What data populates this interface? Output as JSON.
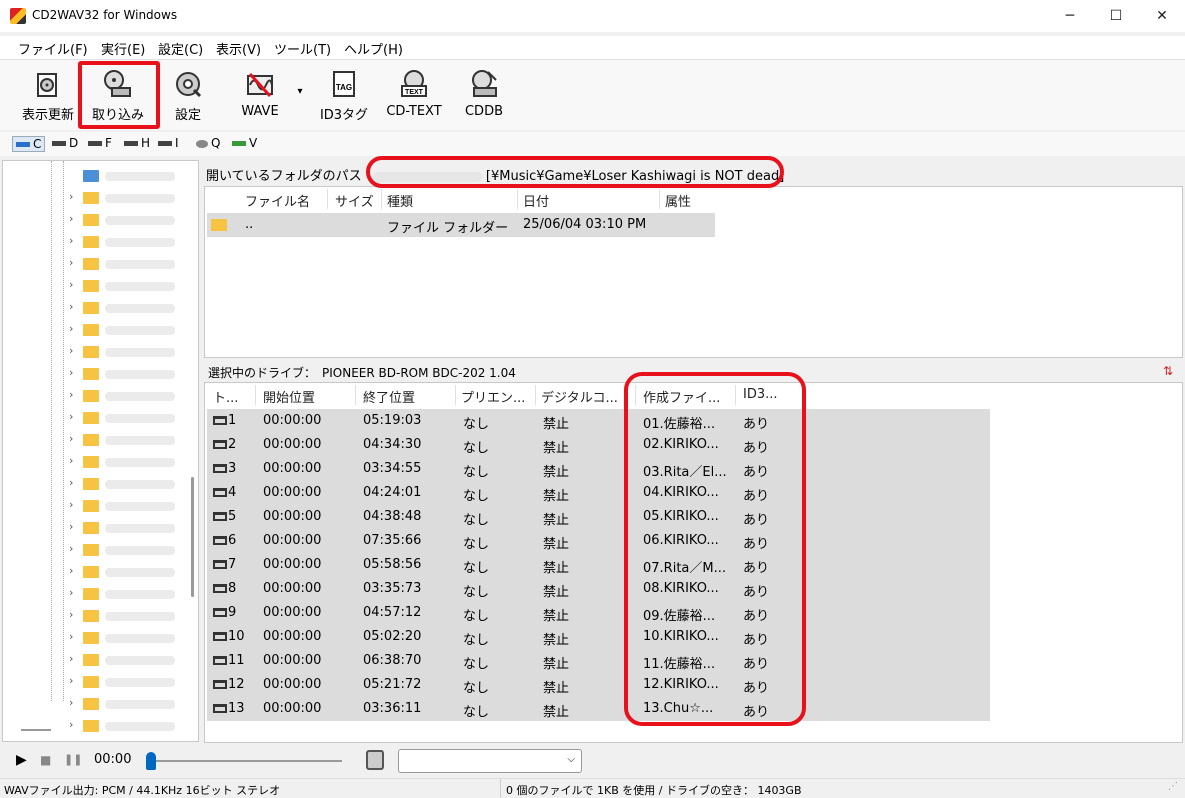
{
  "window": {
    "title": "CD2WAV32 for Windows",
    "minimize": "─",
    "maximize": "☐",
    "close": "✕"
  },
  "menu": [
    "ファイル(F)",
    "実行(E)",
    "設定(C)",
    "表示(V)",
    "ツール(T)",
    "ヘルプ(H)"
  ],
  "toolbar": {
    "refresh": "表示更新",
    "rip": "取り込み",
    "settings": "設定",
    "wave": "WAVE",
    "id3": "ID3タグ",
    "cdtext": "CD-TEXT",
    "cddb": "CDDB",
    "dropdown": "▾"
  },
  "drives": [
    "C",
    "D",
    "F",
    "H",
    "I",
    "Q",
    "V"
  ],
  "path": {
    "label": "開いているフォルダのパス",
    "value": "[¥Music¥Game¥Loser Kashiwagi is NOT dead]"
  },
  "filelist": {
    "headers": [
      "ファイル名",
      "サイズ",
      "種類",
      "日付",
      "属性"
    ],
    "rows": [
      {
        "name": "..",
        "size": "",
        "type": "ファイル フォルダー",
        "date": "25/06/04 03:10 PM",
        "attr": ""
      }
    ]
  },
  "drive_label": "選択中のドライブ：　PIONEER BD-ROM  BDC-202 1.04",
  "tracks": {
    "headers": [
      "ト...",
      "開始位置",
      "終了位置",
      "プリエン...",
      "デジタルコ...",
      "作成ファイ...",
      "ID3..."
    ],
    "rows": [
      [
        "1",
        "00:00:00",
        "05:19:03",
        "なし",
        "禁止",
        "01.佐藤裕...",
        "あり"
      ],
      [
        "2",
        "00:00:00",
        "04:34:30",
        "なし",
        "禁止",
        "02.KIRIKO...",
        "あり"
      ],
      [
        "3",
        "00:00:00",
        "03:34:55",
        "なし",
        "禁止",
        "03.Rita／El...",
        "あり"
      ],
      [
        "4",
        "00:00:00",
        "04:24:01",
        "なし",
        "禁止",
        "04.KIRIKO...",
        "あり"
      ],
      [
        "5",
        "00:00:00",
        "04:38:48",
        "なし",
        "禁止",
        "05.KIRIKO...",
        "あり"
      ],
      [
        "6",
        "00:00:00",
        "07:35:66",
        "なし",
        "禁止",
        "06.KIRIKO...",
        "あり"
      ],
      [
        "7",
        "00:00:00",
        "05:58:56",
        "なし",
        "禁止",
        "07.Rita／M...",
        "あり"
      ],
      [
        "8",
        "00:00:00",
        "03:35:73",
        "なし",
        "禁止",
        "08.KIRIKO...",
        "あり"
      ],
      [
        "9",
        "00:00:00",
        "04:57:12",
        "なし",
        "禁止",
        "09.佐藤裕...",
        "あり"
      ],
      [
        "10",
        "00:00:00",
        "05:02:20",
        "なし",
        "禁止",
        "10.KIRIKO...",
        "あり"
      ],
      [
        "11",
        "00:00:00",
        "06:38:70",
        "なし",
        "禁止",
        "11.佐藤裕...",
        "あり"
      ],
      [
        "12",
        "00:00:00",
        "05:21:72",
        "なし",
        "禁止",
        "12.KIRIKO...",
        "あり"
      ],
      [
        "13",
        "00:00:00",
        "03:36:11",
        "なし",
        "禁止",
        "13.Chu☆...",
        "あり"
      ]
    ]
  },
  "player": {
    "time": "00:00",
    "play": "▶",
    "stop": "■",
    "pause": "❚❚",
    "select_value": ""
  },
  "status": {
    "left": "WAVファイル出力: PCM / 44.1KHz 16ビット ステレオ",
    "right": "0 個のファイルで 1KB を使用 / ドライブの空き： 1403GB"
  },
  "colors": {
    "highlight": "#e8101a",
    "row_bg": "#dcdcdc",
    "folder": "#f6c343"
  }
}
